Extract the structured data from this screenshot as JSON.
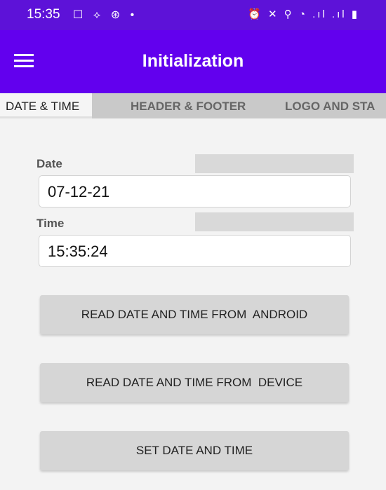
{
  "status_bar": {
    "time": "15:35",
    "left_icons": "☐ ⟡ ⊛ •",
    "right_icons": "⏰ ✕ ⚲ ◔ .ıl .ıl ▮"
  },
  "app_bar": {
    "title": "Initialization"
  },
  "tabs": [
    {
      "label": "DATE & TIME"
    },
    {
      "label": "HEADER & FOOTER"
    },
    {
      "label": "LOGO AND STA"
    }
  ],
  "form": {
    "date_label": "Date",
    "date_value": "07-12-21",
    "time_label": "Time",
    "time_value": "15:35:24"
  },
  "buttons": {
    "read_android": "READ DATE AND TIME FROM  ANDROID",
    "read_device": "READ DATE AND TIME FROM  DEVICE",
    "set": "SET DATE AND TIME"
  },
  "colors": {
    "status_bar": "#5d12d8",
    "app_bar": "#6200ee",
    "background": "#f3f3f3"
  },
  "icons": {
    "menu": "hamburger-menu-icon"
  }
}
